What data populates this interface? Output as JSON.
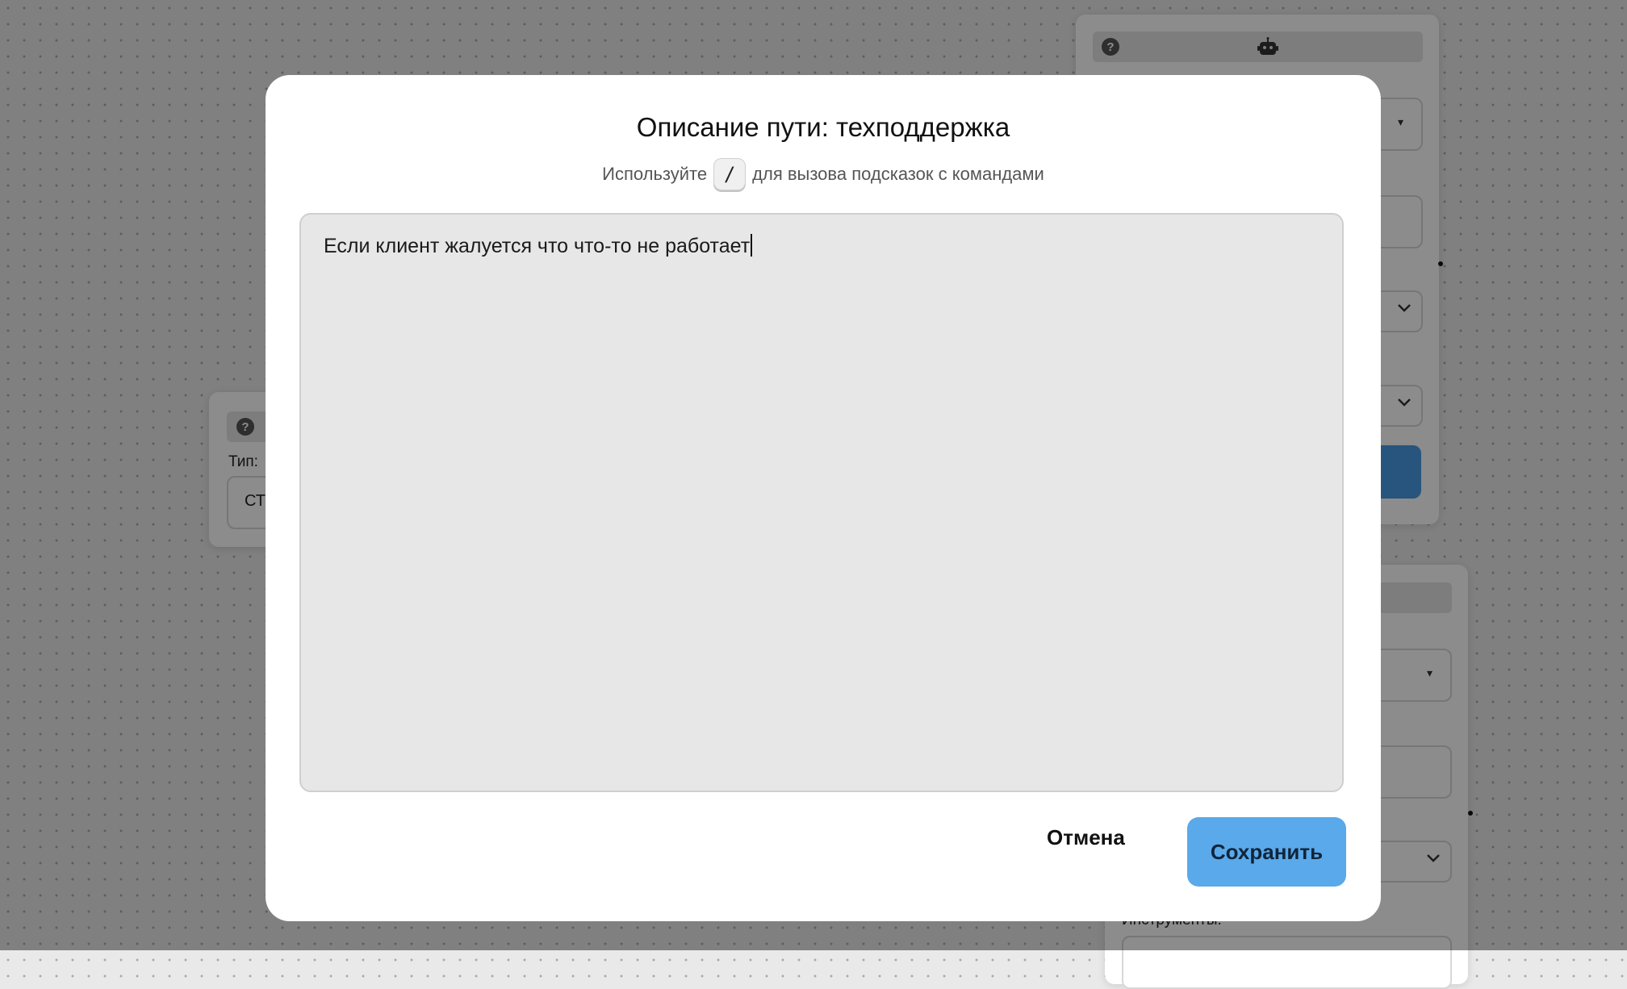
{
  "modal": {
    "title": "Описание пути: техподдержка",
    "hint_before": "Используйте",
    "hint_key": "/",
    "hint_after": "для вызова подсказок с командами",
    "editor_value": "Если клиент жалуется что что-то не работает",
    "cancel_label": "Отмена",
    "save_label": "Сохранить"
  },
  "background": {
    "left_card": {
      "type_label": "Тип:",
      "type_value_fragment": "СТ"
    },
    "bottom_right_card": {
      "tools_label_fragment": "Инструменты:"
    },
    "colors": {
      "accent_blue": "#4a9be3",
      "save_button": "#5aa9ea",
      "editor_bg": "#e7e7e7"
    },
    "icons": [
      "help-icon",
      "robot-icon",
      "chevron-down-icon",
      "caret-down-icon"
    ]
  }
}
